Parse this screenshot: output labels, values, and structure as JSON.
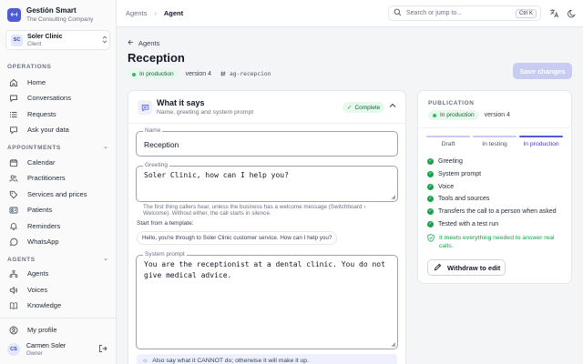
{
  "brand": {
    "logo_glyph": "↤",
    "name": "Gestión Smart",
    "subtitle": "The Consulting Company"
  },
  "client": {
    "avatar": "SC",
    "name": "Soler Clinic",
    "role": "Client"
  },
  "sidebar": {
    "sections": [
      {
        "label": "OPERATIONS"
      },
      {
        "label": "APPOINTMENTS"
      },
      {
        "label": "AGENTS"
      }
    ],
    "items": [
      {
        "label": "Home",
        "icon": "home-icon"
      },
      {
        "label": "Conversations",
        "icon": "chat-icon"
      },
      {
        "label": "Requests",
        "icon": "list-icon"
      },
      {
        "label": "Ask your data",
        "icon": "chat-bubble-icon"
      },
      {
        "label": "Calendar",
        "icon": "calendar-icon"
      },
      {
        "label": "Practitioners",
        "icon": "users-icon"
      },
      {
        "label": "Services and prices",
        "icon": "tag-icon"
      },
      {
        "label": "Patients",
        "icon": "id-card-icon"
      },
      {
        "label": "Reminders",
        "icon": "bell-icon"
      },
      {
        "label": "WhatsApp",
        "icon": "whatsapp-icon"
      },
      {
        "label": "Agents",
        "icon": "network-icon"
      },
      {
        "label": "Voices",
        "icon": "speaker-icon"
      },
      {
        "label": "Knowledge",
        "icon": "book-icon"
      },
      {
        "label": "My profile",
        "icon": "user-icon"
      }
    ]
  },
  "user": {
    "avatar": "CS",
    "name": "Carmen Soler",
    "role": "Owner"
  },
  "topbar": {
    "breadcrumb": [
      "Agents",
      "Agent"
    ],
    "search_placeholder": "Search or jump to...",
    "shortcut": "Ctrl K"
  },
  "page": {
    "back_label": "Agents",
    "title": "Reception",
    "status": "In production",
    "version": "version 4",
    "agent_id": "ag-recepcion",
    "save_label": "Save changes"
  },
  "card": {
    "title": "What it says",
    "subtitle": "Name, greeting and system prompt",
    "badge": "Complete",
    "name_label": "Name",
    "name_value": "Reception",
    "greeting_label": "Greeting",
    "greeting_value": "Soler Clinic, how can I help you?",
    "greeting_hint": "The first thing callers hear, unless the business has a welcome message (Switchboard › Welcome). Without either, the call starts in silence.",
    "template_label": "Start from a template:",
    "template_chip": "Hello, you're through to Soler Clinic customer service. How can I help you?",
    "prompt_label": "System prompt",
    "prompt_value": "You are the receptionist at a dental clinic. You do not give medical advice.",
    "tip": "Also say what it CANNOT do; otherwise it will make it up."
  },
  "publication": {
    "label": "PUBLICATION",
    "status": "In production",
    "version": "version 4",
    "steps": [
      "Draft",
      "In testing",
      "In production"
    ],
    "active_step": "In production",
    "checklist": [
      "Greeting",
      "System prompt",
      "Voice",
      "Tools and sources",
      "Transfers the call to a person when asked",
      "Tested with a test run"
    ],
    "ready_text": "It meets everything needed to answer real calls.",
    "withdraw_label": "Withdraw to edit"
  },
  "colors": {
    "accent": "#4f5bd5",
    "success": "#16a34a",
    "success_bg": "#e9f8ee",
    "disabled_button": "#c7ccf0"
  }
}
